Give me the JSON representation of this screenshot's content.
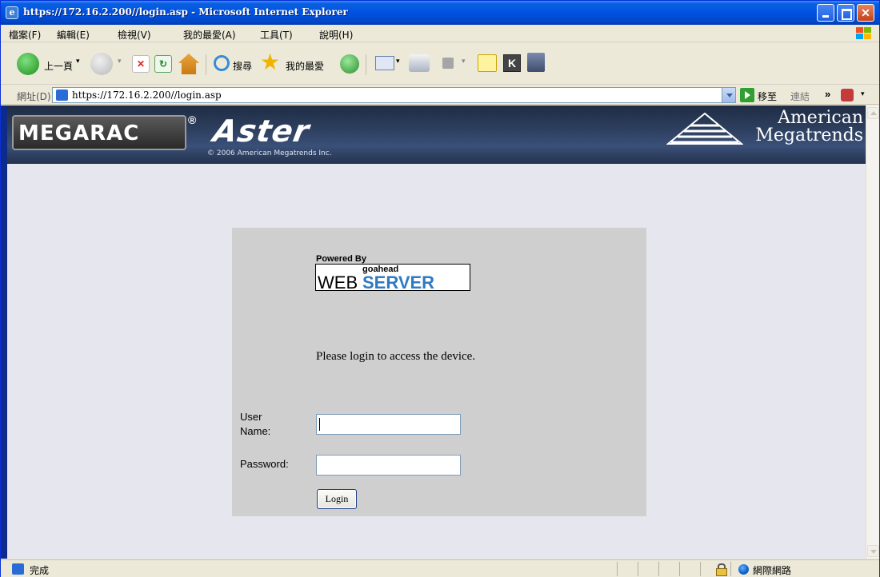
{
  "window": {
    "title": "https://172.16.2.200//login.asp - Microsoft Internet Explorer"
  },
  "menu": [
    "檔案(F)",
    "編輯(E)",
    "檢視(V)",
    "我的最愛(A)",
    "工具(T)",
    "說明(H)"
  ],
  "toolbar": {
    "back_label": "上一頁",
    "search_label": "搜尋",
    "favorites_label": "我的最愛"
  },
  "address": {
    "label": "網址(D)",
    "url": "https://172.16.2.200//login.asp",
    "go_label": "移至",
    "links_label": "連結",
    "links_chevron": "»"
  },
  "banner": {
    "megarac": "MEGARAC",
    "registered": "®",
    "product": "Aster",
    "copyright": "© 2006 American Megatrends Inc.",
    "company_line1": "American",
    "company_line2": "Megatrends"
  },
  "login": {
    "powered_by": "Powered By",
    "goahead": "goahead",
    "web": "WEB",
    "server": "SERVER",
    "message": "Please login to access the device.",
    "username_label_1": "User",
    "username_label_2": "Name:",
    "username_value": "",
    "password_label": "Password:",
    "password_value": "",
    "login_button": "Login"
  },
  "status": {
    "text": "完成",
    "zone": "網際網路"
  },
  "colors": {
    "titlebar": "#0052e0",
    "banner": "#2d3f5e",
    "page_bg": "#e6e6ee",
    "panel_bg": "#cfcfcf",
    "webserver_blue": "#2e7bc4"
  }
}
